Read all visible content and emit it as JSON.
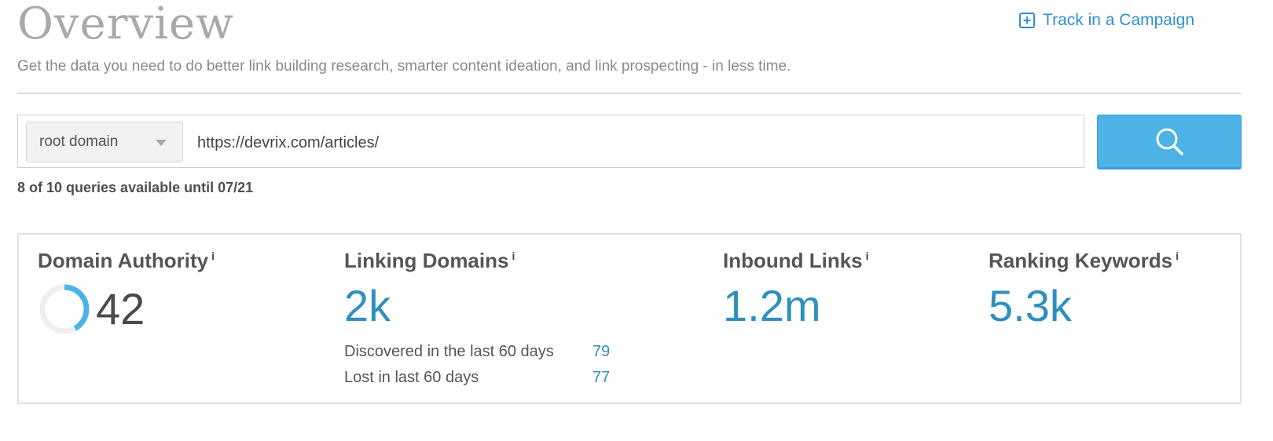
{
  "header": {
    "title": "Overview",
    "subtitle": "Get the data you need to do better link building research, smarter content ideation, and link prospecting - in less time.",
    "track_link_label": "Track in a Campaign"
  },
  "search": {
    "scope_selected": "root domain",
    "url_value": "https://devrix.com/articles/",
    "quota_text": "8 of 10 queries available until 07/21"
  },
  "metrics": {
    "domain_authority": {
      "label": "Domain Authority",
      "info": "i",
      "value": "42",
      "ring_fraction": 0.42
    },
    "linking_domains": {
      "label": "Linking Domains",
      "info": "i",
      "value": "2k",
      "discovered_label": "Discovered in the last 60 days",
      "discovered_value": "79",
      "lost_label": "Lost in last 60 days",
      "lost_value": "77"
    },
    "inbound_links": {
      "label": "Inbound Links",
      "info": "i",
      "value": "1.2m"
    },
    "ranking_keywords": {
      "label": "Ranking Keywords",
      "info": "i",
      "value": "5.3k"
    }
  },
  "colors": {
    "accent": "#2f8fcf",
    "button": "#4db3e6",
    "ring": "#4db3e6",
    "ring_track": "#eeeeee"
  },
  "icons": {
    "track": "plus-square-icon",
    "search": "search-icon",
    "dropdown": "caret-down-icon"
  }
}
